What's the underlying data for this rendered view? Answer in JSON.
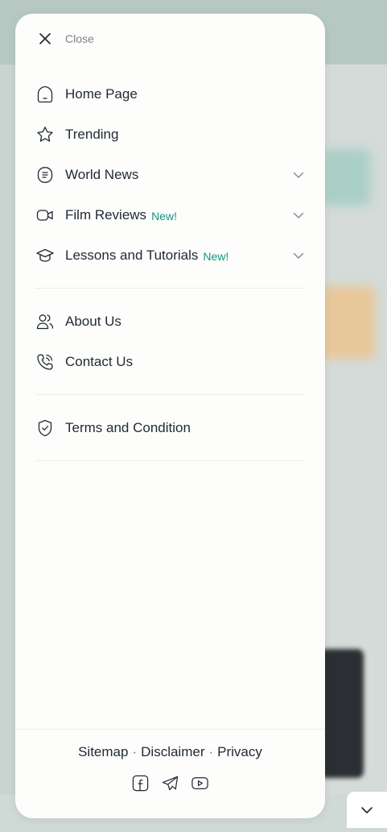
{
  "close_label": "Close",
  "menu": {
    "primary": [
      {
        "label": "Home Page",
        "icon": "home-icon"
      },
      {
        "label": "Trending",
        "icon": "star-icon"
      },
      {
        "label": "World News",
        "icon": "news-icon",
        "expandable": true
      },
      {
        "label": "Film Reviews",
        "icon": "video-icon",
        "badge": "New!",
        "expandable": true
      },
      {
        "label": "Lessons and Tutorials",
        "icon": "graduation-cap-icon",
        "badge": "New!",
        "expandable": true
      }
    ],
    "secondary": [
      {
        "label": "About Us",
        "icon": "users-icon"
      },
      {
        "label": "Contact Us",
        "icon": "phone-icon"
      }
    ],
    "tertiary": [
      {
        "label": "Terms and Condition",
        "icon": "shield-check-icon"
      }
    ]
  },
  "footer": {
    "links": [
      "Sitemap",
      "Disclaimer",
      "Privacy"
    ],
    "separator": "·",
    "social_icons": [
      "facebook-icon",
      "telegram-icon",
      "youtube-icon"
    ]
  },
  "colors": {
    "badge": "#179483",
    "text": "#1f2a33",
    "muted": "#7b8388",
    "drawer_bg": "#fdfdfc"
  }
}
